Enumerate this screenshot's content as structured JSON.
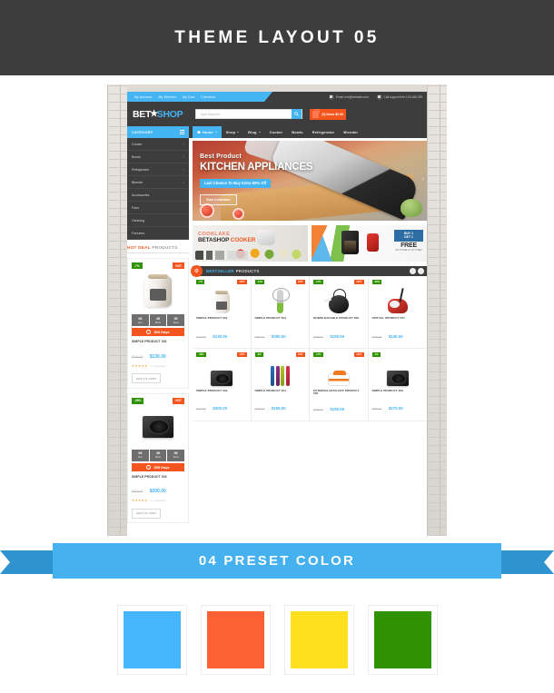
{
  "top_banner": {
    "title": "THEME LAYOUT 05"
  },
  "mockup": {
    "topbar": {
      "links": [
        "My Account",
        "My Wishlist",
        "My Cart",
        "Checkout"
      ],
      "email": "Email:  info@website.com",
      "phone": "Call support free 123-456-789"
    },
    "logo": {
      "part1": "BET",
      "star": "★",
      "part2": "SHOP"
    },
    "search": {
      "placeholder": "Type Keyword",
      "icon": "search-icon"
    },
    "cart": {
      "label": "(0) Items  $0.00",
      "icon": "bag-icon"
    },
    "nav": {
      "category_label": "CATEGORY",
      "items": [
        {
          "label": "Home",
          "active": true,
          "caret": true
        },
        {
          "label": "Shop",
          "active": false,
          "caret": true
        },
        {
          "label": "Blog",
          "active": false,
          "caret": true
        },
        {
          "label": "Cooker",
          "active": false,
          "caret": false
        },
        {
          "label": "Bowls",
          "active": false,
          "caret": false
        },
        {
          "label": "Refrigerator",
          "active": false,
          "caret": false
        },
        {
          "label": "Blender",
          "active": false,
          "caret": false
        }
      ]
    },
    "sidebar": {
      "items": [
        {
          "label": "Cooker",
          "arrow": "›"
        },
        {
          "label": "Bowls",
          "arrow": "›"
        },
        {
          "label": "Refrigerator",
          "arrow": "›"
        },
        {
          "label": "Blender",
          "arrow": "›"
        },
        {
          "label": "Accessories",
          "arrow": ""
        },
        {
          "label": "Fans",
          "arrow": ""
        },
        {
          "label": "Cleaning",
          "arrow": ""
        },
        {
          "label": "Freezers",
          "arrow": ""
        }
      ]
    },
    "hero": {
      "eyebrow": "Best Product",
      "headline": "KITCHEN APPLIANCES",
      "badge": "Last Chance To Buy Extra 50% Off",
      "cta": "View Collection",
      "arrow": "›"
    },
    "hot_deal": {
      "title_highlight": "HOT DEAL",
      "title_rest": "PRODUCTS",
      "products": [
        {
          "sale_badge": "-7%",
          "hot_badge": "HOT",
          "countdown": [
            {
              "n": "08",
              "u": "Hrs"
            },
            {
              "n": "45",
              "u": "Mins"
            },
            {
              "n": "56",
              "u": "Secs"
            }
          ],
          "days": "353 Days",
          "name": "SIMPLE PRODUCT 001",
          "old_price": "$140.00",
          "new_price": "$130.00",
          "stars": "★★★★★",
          "reviews": "1 review(s)",
          "add_to_cart": "ADD TO CART"
        },
        {
          "sale_badge": "-36%",
          "hot_badge": "HOT",
          "countdown": [
            {
              "n": "08",
              "u": "Hrs"
            },
            {
              "n": "45",
              "u": "Mins"
            },
            {
              "n": "56",
              "u": "Secs"
            }
          ],
          "days": "355 Days",
          "name": "SIMPLE PRODUCT 002",
          "old_price": "$310.00",
          "new_price": "$200.00",
          "stars": "★★★★★",
          "reviews": "1 review(s)",
          "add_to_cart": "ADD TO CART"
        }
      ]
    },
    "promos": {
      "promo1": {
        "line1": "COOKLAKE",
        "line2a": "BETASHOP ",
        "line2b": "COOKER"
      },
      "promo2": {
        "buy": "BUY 1",
        "get": "GET 1",
        "free": "FREE",
        "sub": "ON HOME & KITCHEN"
      }
    },
    "bestseller": {
      "title_highlight": "BESTSELLER",
      "title_rest": "PRODUCTS",
      "prev": "‹",
      "next": "›",
      "gear_icon": "gear-icon",
      "products": [
        {
          "sale_badge": "-7%",
          "hot_badge": "HOT",
          "name": "SIMPLE PRODUCT 001",
          "old_price": "$140.00",
          "new_price": "$130.00",
          "shape": "cooker"
        },
        {
          "sale_badge": "-14%",
          "hot_badge": "HOT",
          "name": "SIMPLE PRODUCT 003",
          "old_price": "$350.00",
          "new_price": "$300.00",
          "shape": "whisk"
        },
        {
          "sale_badge": "-17%",
          "hot_badge": "HOT",
          "name": "DOWNLOADABLE PRODUCT 008",
          "old_price": "$180.00",
          "new_price": "$150.00",
          "shape": "kettle"
        },
        {
          "sale_badge": "-26%",
          "hot_badge": "",
          "name": "VIRTUAL PRODUCT 007",
          "old_price": "$190.00",
          "new_price": "$140.00",
          "shape": "vacuum"
        },
        {
          "sale_badge": "-36%",
          "hot_badge": "HOT",
          "name": "SIMPLE PRODUCT 002",
          "old_price": "$310.00",
          "new_price": "$200.00",
          "shape": "induction"
        },
        {
          "sale_badge": "-3%",
          "hot_badge": "HOT",
          "name": "SIMPLE PRODUCT 004",
          "old_price": "$160.00",
          "new_price": "$155.00",
          "shape": "spatulas"
        },
        {
          "sale_badge": "-17%",
          "hot_badge": "HOT",
          "name": "EXTERNAL/AFFILIATE PRODUCT 005",
          "old_price": "$180.00",
          "new_price": "$150.00",
          "shape": "lunchbox"
        },
        {
          "sale_badge": "-1%",
          "hot_badge": "",
          "name": "SIMPLE PRODUCT 006",
          "old_price": "$280.00",
          "new_price": "$270.00",
          "shape": "induction2"
        }
      ]
    }
  },
  "preset_ribbon": {
    "title": "04 PRESET COLOR"
  },
  "swatches": [
    {
      "name": "blue-swatch",
      "color": "#45b6fc"
    },
    {
      "name": "orange-swatch",
      "color": "#fb6134"
    },
    {
      "name": "yellow-swatch",
      "color": "#ffe01e"
    },
    {
      "name": "green-swatch",
      "color": "#2f9200"
    }
  ]
}
